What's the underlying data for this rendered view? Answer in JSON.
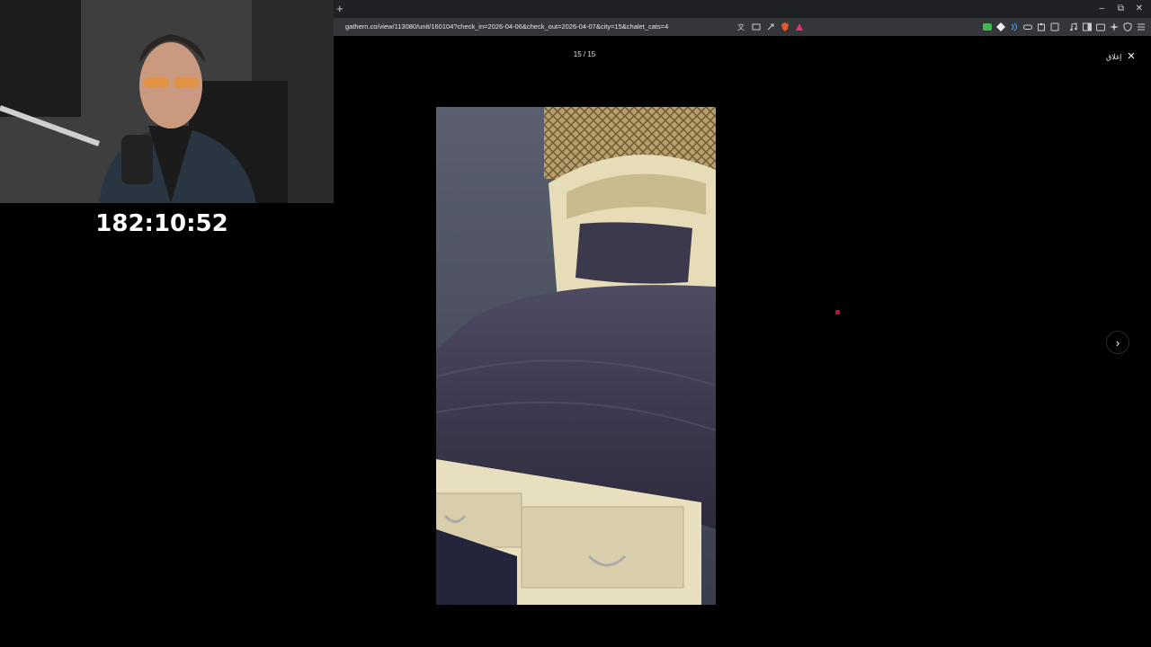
{
  "browser": {
    "new_tab_symbol": "+",
    "url": "gathern.co/view/113080/unit/160104?check_in=2026-04-06&check_out=2026-04-07&city=15&chalet_cats=4",
    "window_controls": {
      "minimize": "–",
      "restore": "⧉",
      "close": "✕"
    }
  },
  "lightbox": {
    "counter": "15 / 15",
    "close_label": "إغلاق",
    "close_symbol": "✕",
    "next_symbol": "›",
    "photo_icon": "bed-photo"
  },
  "stream": {
    "timer": "182:10:52"
  },
  "colors": {
    "background": "#000000",
    "tab_bar": "#202124",
    "address_bar": "#35363a",
    "cursor": "#c1121f"
  }
}
